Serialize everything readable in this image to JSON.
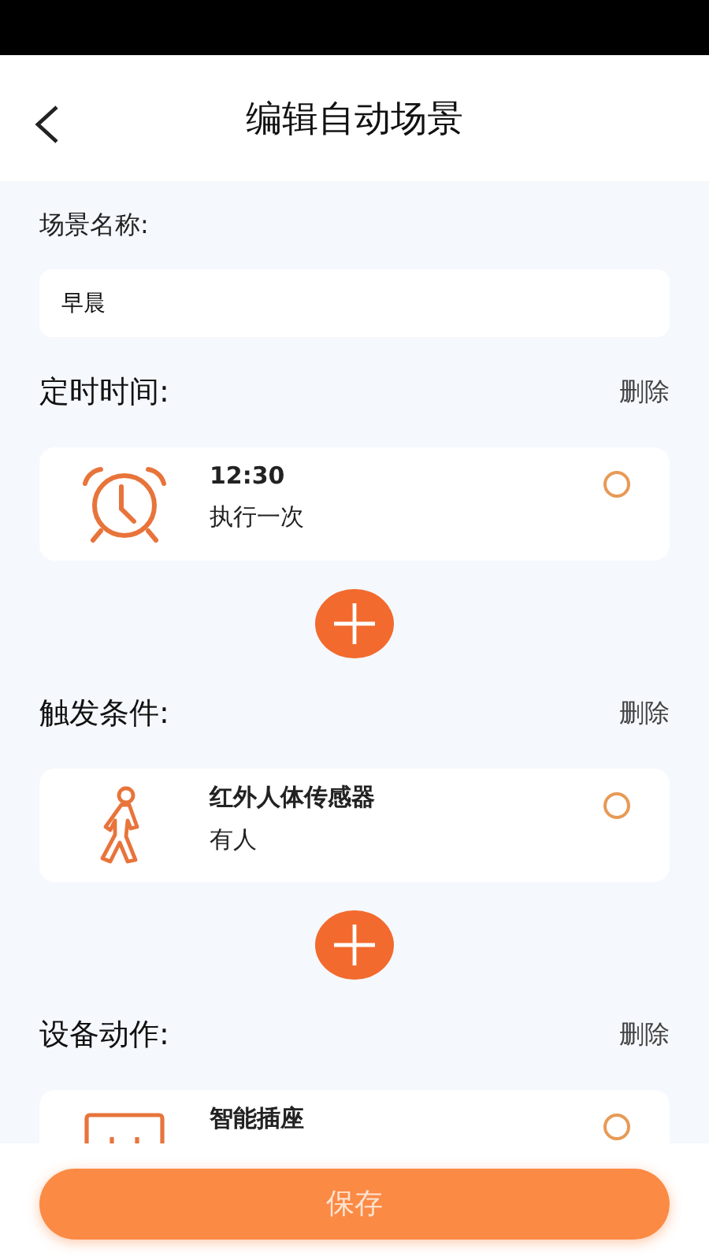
{
  "header": {
    "title": "编辑自动场景"
  },
  "name_field": {
    "label": "场景名称:",
    "value": "早晨"
  },
  "sections": [
    {
      "kind": "timer",
      "title": "定时时间:",
      "delete": "删除",
      "item": {
        "title": "12:30",
        "subtitle": "执行一次",
        "selected": false
      },
      "add_button": true
    },
    {
      "kind": "trigger",
      "title": "触发条件:",
      "delete": "删除",
      "item": {
        "title": "红外人体传感器",
        "subtitle": "有人",
        "selected": false
      },
      "add_button": true
    },
    {
      "kind": "action",
      "title": "设备动作:",
      "delete": "删除",
      "item": {
        "title": "智能插座",
        "selected": false
      },
      "add_button": false
    }
  ],
  "save_button": "保存"
}
